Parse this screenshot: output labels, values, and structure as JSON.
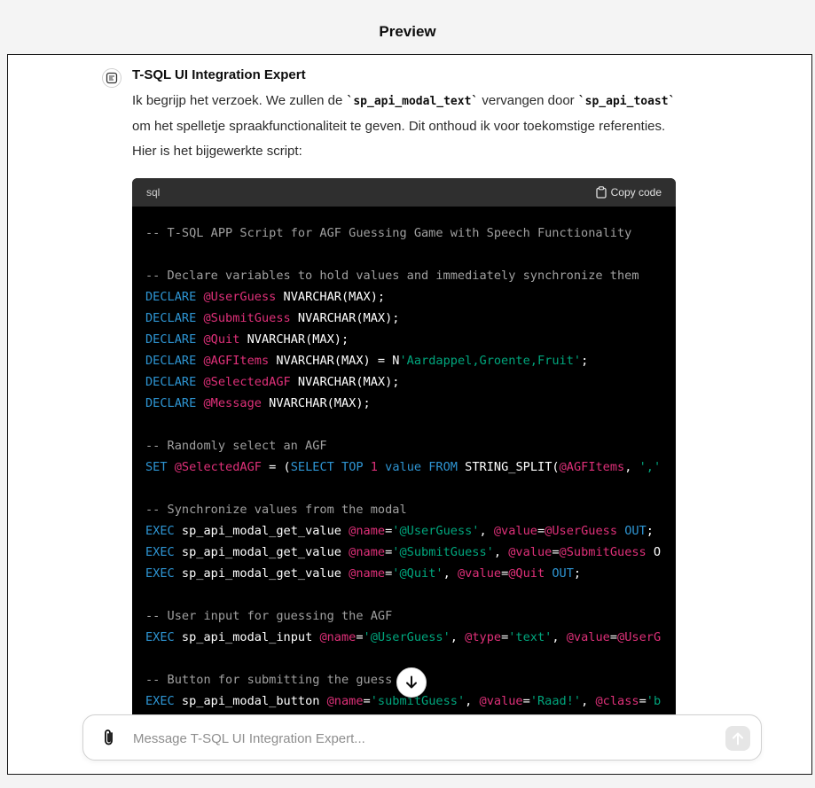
{
  "header": {
    "title": "Preview"
  },
  "message": {
    "author": "T-SQL UI Integration Expert",
    "text_1": "Ik begrijp het verzoek. We zullen de ",
    "code_1": "`sp_api_modal_text`",
    "text_2": " vervangen door ",
    "code_2": "`sp_api_toast`",
    "text_3": " om het spelletje spraakfunctionaliteit te geven. Dit onthoud ik voor toekomstige referenties. Hier is het bijgewerkte script:"
  },
  "code_block": {
    "language": "sql",
    "copy_label": "Copy code",
    "lines": [
      "-- T-SQL APP Script for AGF Guessing Game with Speech Functionality",
      "",
      "-- Declare variables to hold values and immediately synchronize them",
      "DECLARE @UserGuess NVARCHAR(MAX);",
      "DECLARE @SubmitGuess NVARCHAR(MAX);",
      "DECLARE @Quit NVARCHAR(MAX);",
      "DECLARE @AGFItems NVARCHAR(MAX) = N'Aardappel,Groente,Fruit';",
      "DECLARE @SelectedAGF NVARCHAR(MAX);",
      "DECLARE @Message NVARCHAR(MAX);",
      "",
      "-- Randomly select an AGF",
      "SET @SelectedAGF = (SELECT TOP 1 value FROM STRING_SPLIT(@AGFItems, ','",
      "",
      "-- Synchronize values from the modal",
      "EXEC sp_api_modal_get_value @name='@UserGuess', @value=@UserGuess OUT;",
      "EXEC sp_api_modal_get_value @name='@SubmitGuess', @value=@SubmitGuess O",
      "EXEC sp_api_modal_get_value @name='@Quit', @value=@Quit OUT;",
      "",
      "-- User input for guessing the AGF",
      "EXEC sp_api_modal_input @name='@UserGuess', @type='text', @value=@UserG",
      "",
      "-- Button for submitting the guess",
      "EXEC sp_api_modal_button @name='submitGuess', @value='Raad!', @class='b"
    ]
  },
  "composer": {
    "placeholder": "Message T-SQL UI Integration Expert..."
  },
  "icons": {
    "avatar": "gpt-avatar-icon",
    "copy": "clipboard-icon",
    "scroll": "arrow-down-icon",
    "attach": "paperclip-icon",
    "send": "arrow-up-icon"
  }
}
